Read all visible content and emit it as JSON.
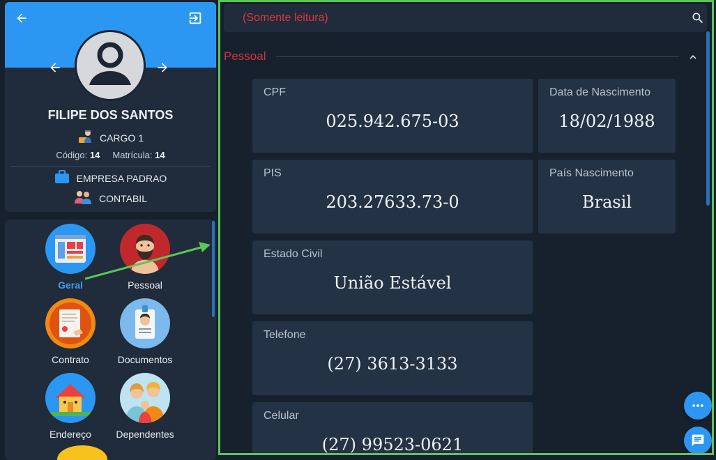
{
  "profile": {
    "name": "FILIPE DOS SANTOS",
    "cargo": "CARGO 1",
    "codigo_label": "Código:",
    "codigo_value": "14",
    "matricula_label": "Matrícula:",
    "matricula_value": "14",
    "empresa": "EMPRESA PADRAO",
    "departamento": "CONTABIL"
  },
  "menu": {
    "items": [
      {
        "label": "Geral",
        "icon": "document-layout-icon",
        "active": true
      },
      {
        "label": "Pessoal",
        "icon": "bearded-man-icon"
      },
      {
        "label": "Contrato",
        "icon": "contract-icon"
      },
      {
        "label": "Documentos",
        "icon": "id-badge-icon"
      },
      {
        "label": "Endereço",
        "icon": "house-icon"
      },
      {
        "label": "Dependentes",
        "icon": "family-icon"
      }
    ]
  },
  "content": {
    "readonly_label": "(Somente leitura)",
    "section_title": "Pessoal",
    "fields": [
      {
        "label": "CPF",
        "value": "025.942.675-03"
      },
      {
        "label": "Data de Nascimento",
        "value": "18/02/1988"
      },
      {
        "label": "PIS",
        "value": "203.27633.73-0"
      },
      {
        "label": "País Nascimento",
        "value": "Brasil"
      },
      {
        "label": "Estado Civil",
        "value": "União Estável"
      },
      {
        "label": "Telefone",
        "value": "(27) 3613-3133"
      },
      {
        "label": "Celular",
        "value": "(27) 99523-0621"
      }
    ]
  },
  "colors": {
    "accent_blue": "#2b97f3",
    "readonly_red": "#e0343f",
    "highlight_green": "#5cc55a",
    "card_bg": "#243245"
  }
}
